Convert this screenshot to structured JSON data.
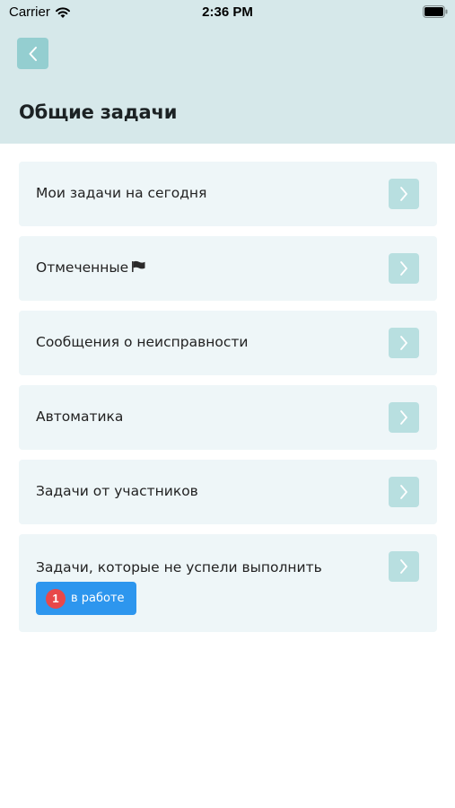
{
  "status_bar": {
    "carrier": "Carrier",
    "time": "2:36 PM"
  },
  "header": {
    "title": "Общие задачи",
    "back_icon": "chevron-left-icon"
  },
  "tasks": [
    {
      "label": "Мои задачи на сегодня",
      "icon": "chevron-right-icon"
    },
    {
      "label": "Отмеченные",
      "flag": "flag-icon",
      "icon": "chevron-right-icon"
    },
    {
      "label": "Сообщения о неисправности",
      "icon": "chevron-right-icon"
    },
    {
      "label": "Автоматика",
      "icon": "chevron-right-icon"
    },
    {
      "label": "Задачи от участников",
      "icon": "chevron-right-icon"
    },
    {
      "label": "Задачи, которые не успели выполнить",
      "icon": "chevron-right-icon",
      "chip": {
        "count": "1",
        "label": "в работе"
      }
    }
  ],
  "colors": {
    "header_bg": "#d6e8ea",
    "card_bg": "#eef6f8",
    "accent": "#94ced0",
    "chip_bg": "#2d96ee",
    "badge_bg": "#e8484a"
  }
}
